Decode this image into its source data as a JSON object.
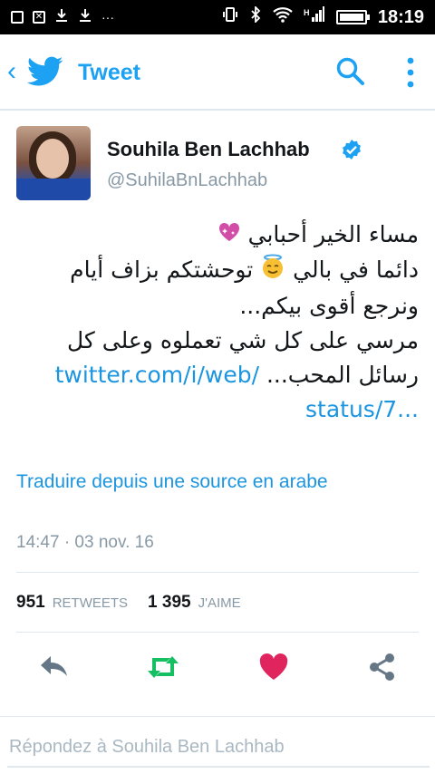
{
  "status_bar": {
    "time": "18:19",
    "network": "H",
    "ellipsis": "···"
  },
  "app_bar": {
    "title": "Tweet",
    "icons": [
      "back-chevron-icon",
      "twitter-bird-icon",
      "search-icon",
      "more-vertical-icon"
    ]
  },
  "tweet": {
    "author_name": "Souhila Ben Lachhab",
    "author_handle": "@SuhilaBnLachhab",
    "verified": true,
    "lines": [
      "مساء الخير أحبابي",
      "دائما في بالي",
      "توحشتكم بزاف أيام",
      "ونرجع أقوى بيكم...",
      "مرسي على كل شي تعملوه وعلى كل",
      "رسائل المحب..."
    ],
    "link_part1": "twitter.com/i/web/",
    "link_part2": "status/7...",
    "emojis": [
      "sparkling-heart-icon",
      "halo-smile-icon"
    ],
    "translate_label": "Traduire depuis une source en arabe",
    "timestamp": "14:47 · 03 nov. 16"
  },
  "stats": {
    "retweets_count": "951",
    "retweets_label": "RETWEETS",
    "likes_count": "1 395",
    "likes_label": "J'AIME"
  },
  "actions": {
    "icons": [
      "reply-icon",
      "retweet-icon",
      "like-icon",
      "share-icon"
    ],
    "colors": {
      "retweet": "#17bf63",
      "like": "#e0245e",
      "neutral": "#657786"
    }
  },
  "reply": {
    "placeholder": "Répondez à Souhila Ben Lachhab"
  },
  "colors": {
    "accent": "#1da1f2",
    "link": "#1b95e0",
    "muted": "#8899a6"
  }
}
